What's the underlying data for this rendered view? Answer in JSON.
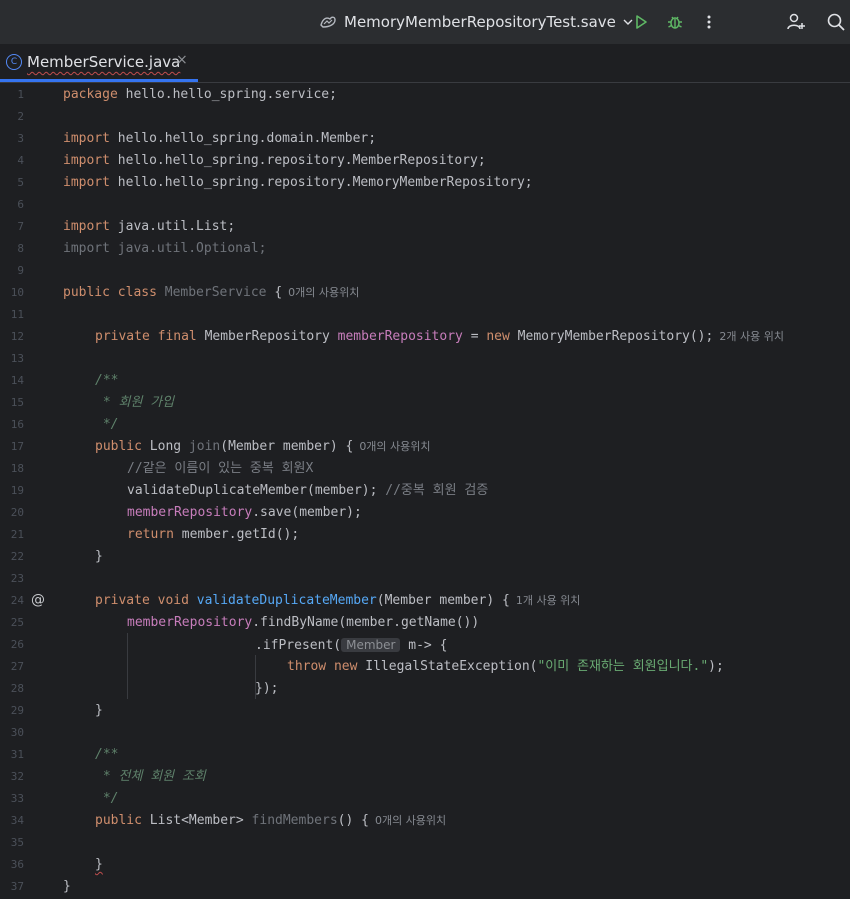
{
  "toolbar": {
    "run_config": "MemoryMemberRepositoryTest.save",
    "icons": [
      "run-config-icon",
      "chevron-down-icon",
      "run-icon",
      "debug-icon",
      "more-icon",
      "add-user-icon",
      "search-icon"
    ]
  },
  "tab": {
    "title": "MemberService.java",
    "icon": "C",
    "close": "×"
  },
  "colors": {
    "keyword": "#cf8e6d",
    "field": "#c77dbb",
    "function": "#56a8f5",
    "string": "#6aab73",
    "doc": "#5f826b",
    "accent": "#3574f0"
  },
  "line_numbers": [
    "1",
    "2",
    "3",
    "4",
    "5",
    "6",
    "7",
    "8",
    "9",
    "10",
    "11",
    "12",
    "13",
    "14",
    "15",
    "16",
    "17",
    "18",
    "19",
    "20",
    "21",
    "22",
    "23",
    "24",
    "25",
    "26",
    "27",
    "28",
    "29",
    "30",
    "31",
    "32",
    "33",
    "34",
    "35",
    "36",
    "37"
  ],
  "gutter": {
    "override_mark": "@"
  },
  "code": {
    "l1": {
      "kw": "package",
      "rest": " hello.hello_spring.service;"
    },
    "l3": {
      "kw": "import",
      "rest": " hello.hello_spring.domain.Member;"
    },
    "l4": {
      "kw": "import",
      "rest": " hello.hello_spring.repository.MemberRepository;"
    },
    "l5": {
      "kw": "import",
      "rest": " hello.hello_spring.repository.MemoryMemberRepository;"
    },
    "l7": {
      "kw": "import",
      "rest": " java.util.List;"
    },
    "l8": {
      "text": "import java.util.Optional;"
    },
    "l10": {
      "kw": "public class",
      "name": " MemberService",
      "rest": " {",
      "hint": "0개의 사용위치"
    },
    "l12": {
      "kw": "private final",
      "type": " MemberRepository ",
      "field": "memberRepository",
      "eq": " = ",
      "kw2": "new",
      "rest": " MemoryMemberRepository();",
      "hint": "2개 사용 위치"
    },
    "l14": "/**",
    "l15": " * 회원 가입",
    "l16": " */",
    "l17": {
      "kw": "public",
      "type": " Long ",
      "name": "join",
      "rest": "(Member member) {",
      "hint": "0개의 사용위치"
    },
    "l18": "//같은 이름이 있는 중복 회원X",
    "l19": {
      "code": "validateDuplicateMember(member); ",
      "comment": "//중복 회원 검증"
    },
    "l20": {
      "field": "memberRepository",
      "rest": ".save(member);"
    },
    "l21": {
      "kw": "return",
      "rest": " member.getId();"
    },
    "l22": "}",
    "l24": {
      "kw": "private void",
      "name": " validateDuplicateMember",
      "rest": "(Member member) {",
      "hint": "1개 사용 위치"
    },
    "l25": {
      "field": "memberRepository",
      "rest": ".findByName(member.getName())"
    },
    "l26": {
      "code": ".ifPresent(",
      "inlay": "Member",
      "rest": " m-> {"
    },
    "l27": {
      "kw": "throw new",
      "rest": " IllegalStateException(",
      "str": "\"이미 존재하는 회원입니다.\"",
      "end": ");"
    },
    "l28": "});",
    "l29": "}",
    "l31": "/**",
    "l32": " * 전체 회원 조회",
    "l33": " */",
    "l34": {
      "kw": "public",
      "type": " List<Member> ",
      "name": "findMembers",
      "rest": "() {",
      "hint": "0개의 사용위치"
    },
    "l36": "}",
    "l37": "}"
  }
}
